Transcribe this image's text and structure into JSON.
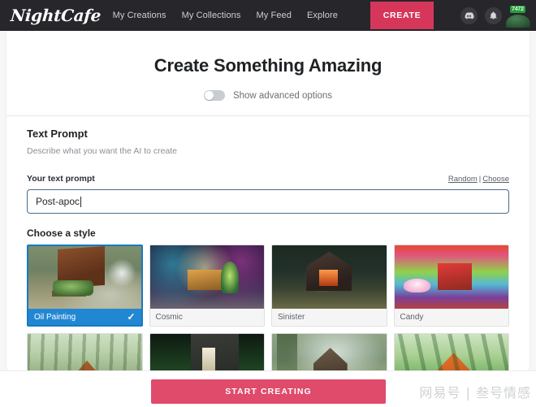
{
  "header": {
    "logo": "NightCafe",
    "nav": [
      {
        "label": "My Creations"
      },
      {
        "label": "My Collections"
      },
      {
        "label": "My Feed"
      },
      {
        "label": "Explore"
      }
    ],
    "create_label": "CREATE",
    "icons": [
      {
        "name": "discord-icon"
      },
      {
        "name": "bell-icon"
      }
    ],
    "avatar_badge": "7472"
  },
  "main": {
    "title": "Create Something Amazing",
    "advanced_toggle_label": "Show advanced options",
    "advanced_toggle_on": false,
    "text_prompt": {
      "heading": "Text Prompt",
      "subtitle": "Describe what you want the AI to create",
      "field_label": "Your text prompt",
      "random_link": "Random",
      "separator": "|",
      "choose_link": "Choose",
      "value": "Post-apoc",
      "placeholder": "Your text prompt"
    },
    "styles": {
      "heading": "Choose a style",
      "selected": "Oil Painting",
      "check_glyph": "✓",
      "items": [
        {
          "label": "Oil Painting",
          "selected": true,
          "art": "t1"
        },
        {
          "label": "Cosmic",
          "selected": false,
          "art": "t2"
        },
        {
          "label": "Sinister",
          "selected": false,
          "art": "t3"
        },
        {
          "label": "Candy",
          "selected": false,
          "art": "t4"
        },
        {
          "label": "",
          "selected": false,
          "art": "t5"
        },
        {
          "label": "",
          "selected": false,
          "art": "t6"
        },
        {
          "label": "",
          "selected": false,
          "art": "t7"
        },
        {
          "label": "",
          "selected": false,
          "art": "t8"
        }
      ]
    }
  },
  "footer": {
    "start_label": "START CREATING",
    "watermark": "网易号 | 叁号情感"
  },
  "colors": {
    "header_bg": "#26262b",
    "create_btn": "#d6365a",
    "start_btn": "#e04a6b",
    "selected_card": "#2287d3",
    "input_border": "#4a6a8a",
    "badge_green": "#2a9b3e"
  }
}
